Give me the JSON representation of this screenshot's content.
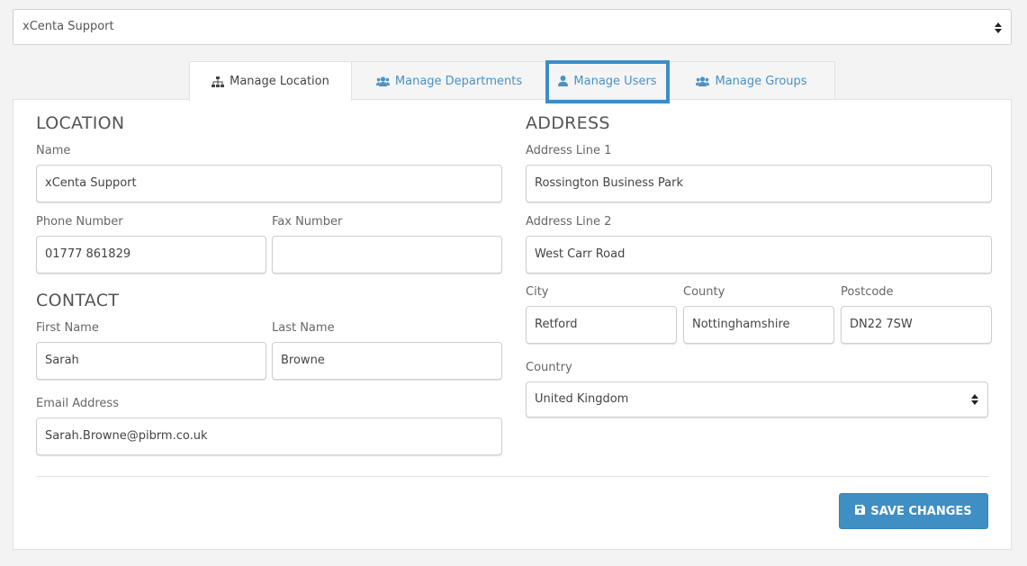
{
  "location_select": {
    "value": "xCenta Support"
  },
  "tabs": [
    {
      "label": "Manage Location",
      "icon": "sitemap-icon",
      "active": true
    },
    {
      "label": "Manage Departments",
      "icon": "users-icon",
      "active": false
    },
    {
      "label": "Manage Users",
      "icon": "user-icon",
      "active": false,
      "highlighted": true
    },
    {
      "label": "Manage Groups",
      "icon": "users-icon",
      "active": false
    }
  ],
  "location": {
    "title": "LOCATION",
    "name_label": "Name",
    "name_value": "xCenta Support",
    "phone_label": "Phone Number",
    "phone_value": "01777 861829",
    "fax_label": "Fax Number",
    "fax_value": ""
  },
  "contact": {
    "title": "CONTACT",
    "first_label": "First Name",
    "first_value": "Sarah",
    "last_label": "Last Name",
    "last_value": "Browne",
    "email_label": "Email Address",
    "email_value": "Sarah.Browne@pibrm.co.uk"
  },
  "address": {
    "title": "ADDRESS",
    "line1_label": "Address Line 1",
    "line1_value": "Rossington Business Park",
    "line2_label": "Address Line 2",
    "line2_value": "West Carr Road",
    "city_label": "City",
    "city_value": "Retford",
    "county_label": "County",
    "county_value": "Nottinghamshire",
    "postcode_label": "Postcode",
    "postcode_value": "DN22 7SW",
    "country_label": "Country",
    "country_value": "United Kingdom"
  },
  "actions": {
    "save_label": "SAVE CHANGES",
    "save_icon": "floppy-disk-icon"
  },
  "colors": {
    "accent": "#3f8fc5",
    "tab_link": "#4a90c4",
    "highlight": "#3a8ec8"
  }
}
